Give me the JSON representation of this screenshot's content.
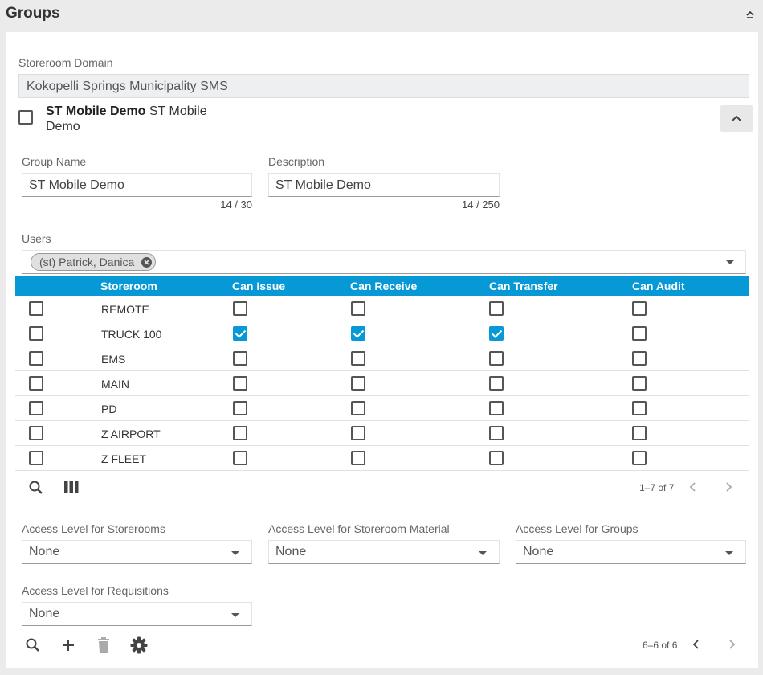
{
  "header": {
    "title": "Groups"
  },
  "domain": {
    "label": "Storeroom Domain",
    "value": "Kokopelli Springs Municipality SMS"
  },
  "group": {
    "name_bold": "ST Mobile Demo",
    "name_rest": " ST Mobile Demo"
  },
  "form": {
    "group_name_label": "Group Name",
    "group_name_value": "ST Mobile Demo",
    "group_name_counter": "14 / 30",
    "description_label": "Description",
    "description_value": "ST Mobile Demo",
    "description_counter": "14 / 250",
    "users_label": "Users",
    "users_chips": [
      "(st) Patrick, Danica"
    ]
  },
  "grid": {
    "columns": [
      "Storeroom",
      "Can Issue",
      "Can Receive",
      "Can Transfer",
      "Can Audit"
    ],
    "rows": [
      {
        "storeroom": "REMOTE",
        "selected": false,
        "issue": false,
        "receive": false,
        "transfer": false,
        "audit": false
      },
      {
        "storeroom": "TRUCK 100",
        "selected": false,
        "issue": true,
        "receive": true,
        "transfer": true,
        "audit": false
      },
      {
        "storeroom": "EMS",
        "selected": false,
        "issue": false,
        "receive": false,
        "transfer": false,
        "audit": false
      },
      {
        "storeroom": "MAIN",
        "selected": false,
        "issue": false,
        "receive": false,
        "transfer": false,
        "audit": false
      },
      {
        "storeroom": "PD",
        "selected": false,
        "issue": false,
        "receive": false,
        "transfer": false,
        "audit": false
      },
      {
        "storeroom": "Z AIRPORT",
        "selected": false,
        "issue": false,
        "receive": false,
        "transfer": false,
        "audit": false
      },
      {
        "storeroom": "Z FLEET",
        "selected": false,
        "issue": false,
        "receive": false,
        "transfer": false,
        "audit": false
      }
    ],
    "pager": "1–7 of 7"
  },
  "access": {
    "storerooms_label": "Access Level for Storerooms",
    "storerooms_value": "None",
    "material_label": "Access Level for Storeroom Material",
    "material_value": "None",
    "groups_label": "Access Level for Groups",
    "groups_value": "None",
    "requisitions_label": "Access Level for Requisitions",
    "requisitions_value": "None"
  },
  "footer": {
    "pager": "6–6 of 6"
  },
  "colors": {
    "accent": "#0699d6",
    "header_line": "#2b8a9a"
  },
  "icons": [
    "chevron-up-icon",
    "search-icon",
    "columns-icon",
    "add-icon",
    "trash-icon",
    "gear-icon",
    "chevron-left-icon",
    "chevron-right-icon",
    "close-circle-icon",
    "dropdown-arrow-icon"
  ]
}
